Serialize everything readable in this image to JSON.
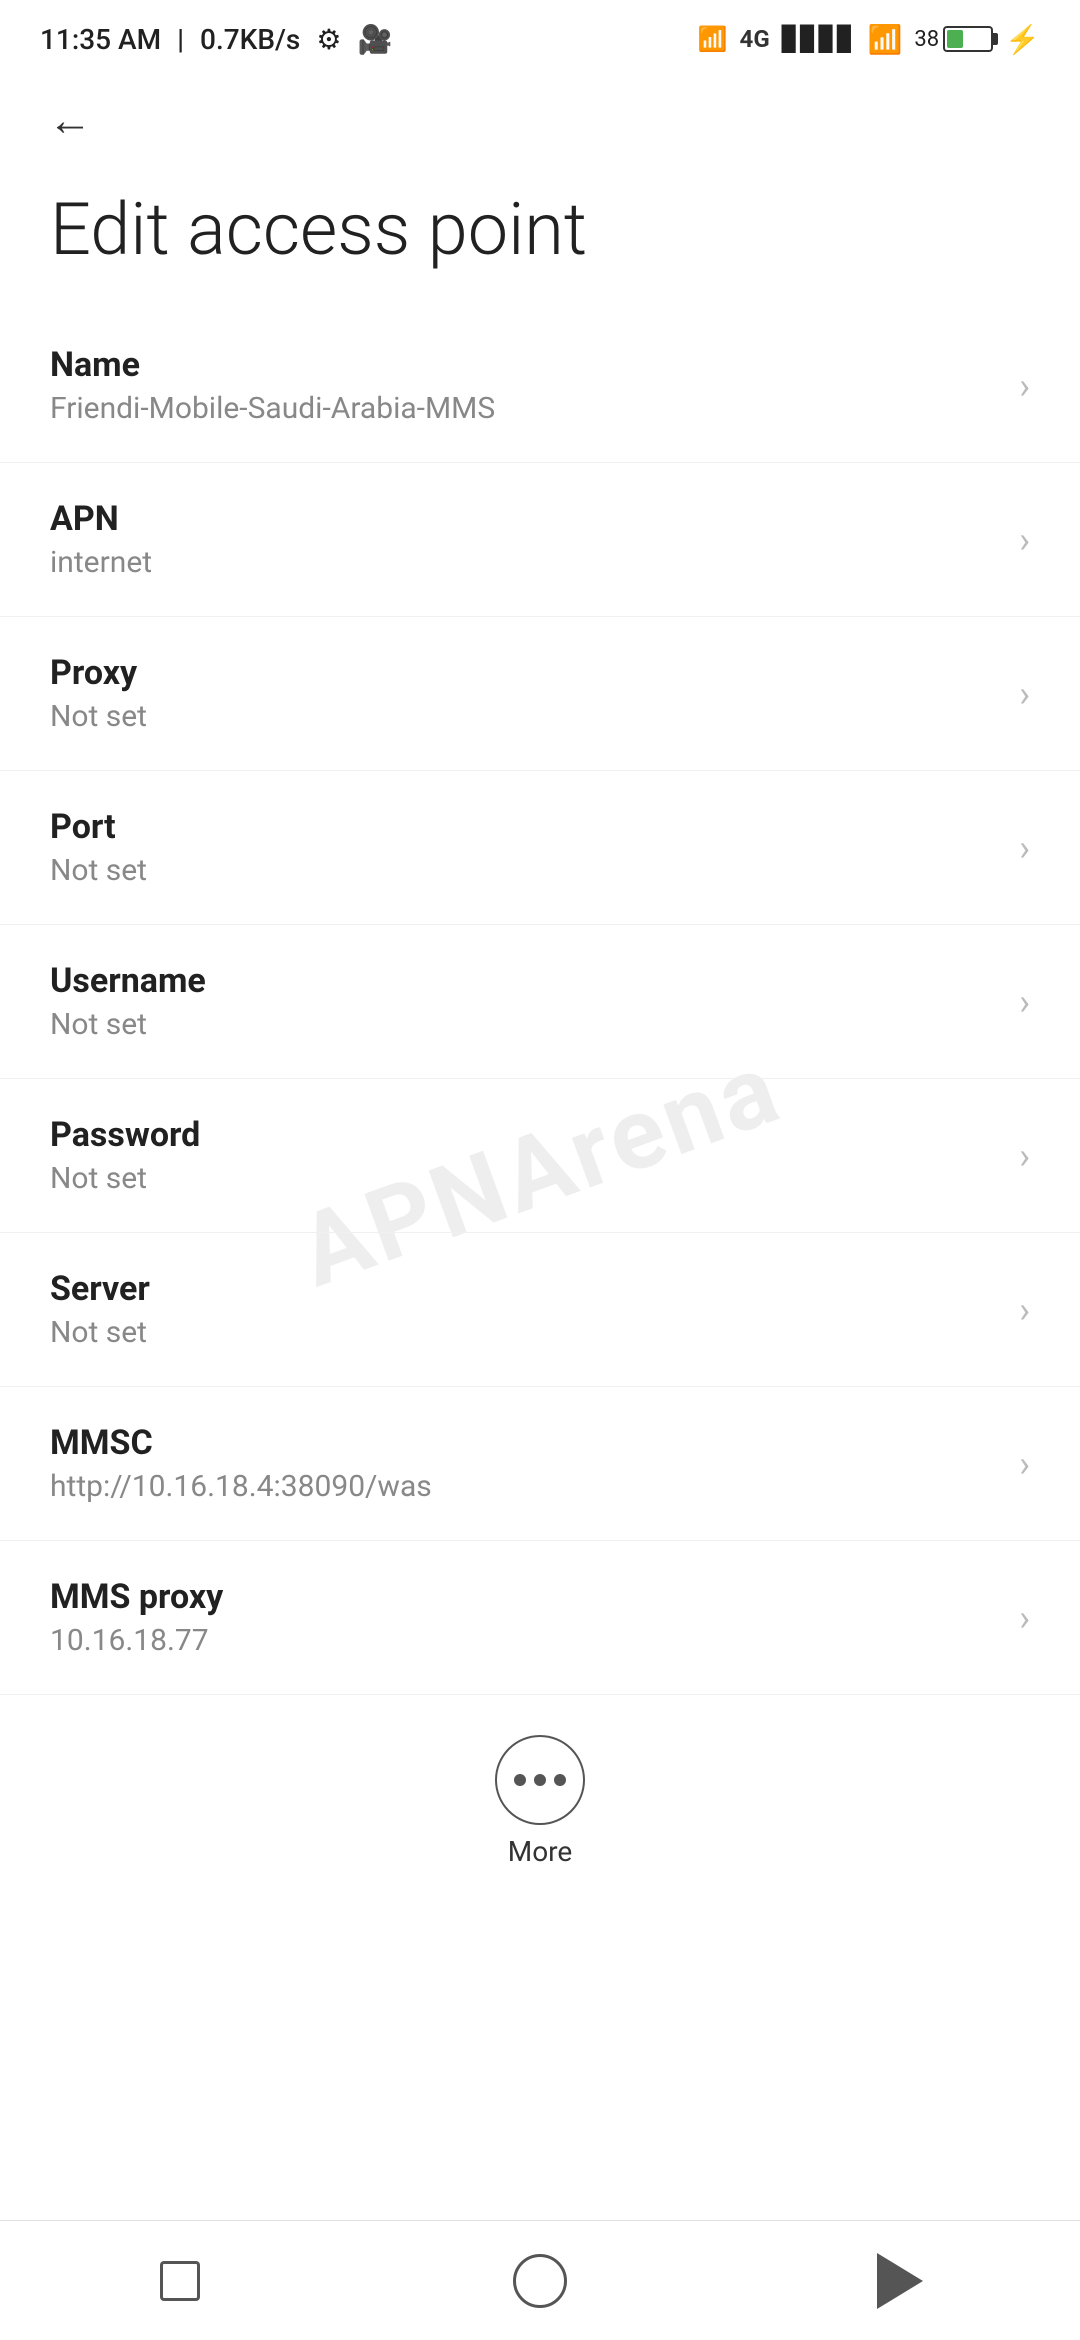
{
  "statusBar": {
    "time": "11:35 AM",
    "speed": "0.7KB/s"
  },
  "nav": {
    "backLabel": "←"
  },
  "page": {
    "title": "Edit access point"
  },
  "settings": [
    {
      "label": "Name",
      "value": "Friendi-Mobile-Saudi-Arabia-MMS"
    },
    {
      "label": "APN",
      "value": "internet"
    },
    {
      "label": "Proxy",
      "value": "Not set"
    },
    {
      "label": "Port",
      "value": "Not set"
    },
    {
      "label": "Username",
      "value": "Not set"
    },
    {
      "label": "Password",
      "value": "Not set"
    },
    {
      "label": "Server",
      "value": "Not set"
    },
    {
      "label": "MMSC",
      "value": "http://10.16.18.4:38090/was"
    },
    {
      "label": "MMS proxy",
      "value": "10.16.18.77"
    }
  ],
  "more": {
    "label": "More"
  },
  "watermark": "APNArena"
}
